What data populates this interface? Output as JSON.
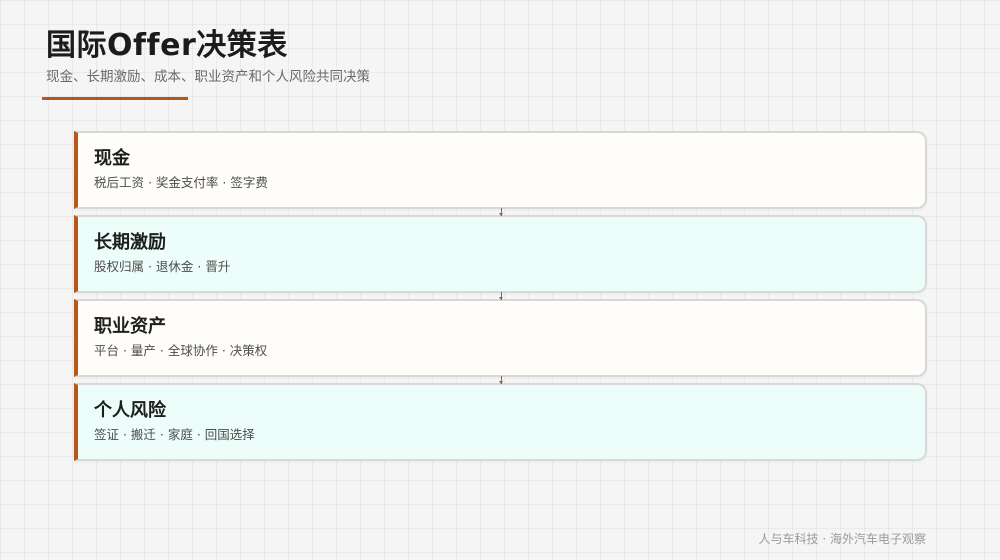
{
  "header": {
    "title": "国际Offer决策表",
    "subtitle": "现金、长期激励、成本、职业资产和个人风险共同决策"
  },
  "cards": [
    {
      "title": "现金",
      "desc": "税后工资 · 奖金支付率 · 签字费"
    },
    {
      "title": "长期激励",
      "desc": "股权归属 · 退休金 · 晋升"
    },
    {
      "title": "职业资产",
      "desc": "平台 · 量产 · 全球协作 · 决策权"
    },
    {
      "title": "个人风险",
      "desc": "签证 · 搬迁 · 家庭 · 回国选择"
    }
  ],
  "footer": {
    "note": "人与车科技 · 海外汽车电子观察"
  },
  "colors": {
    "accent": "#b5581a",
    "card_light": "#fefdf9",
    "card_tint": "#ecfdfa",
    "border": "#d8d8d8"
  }
}
